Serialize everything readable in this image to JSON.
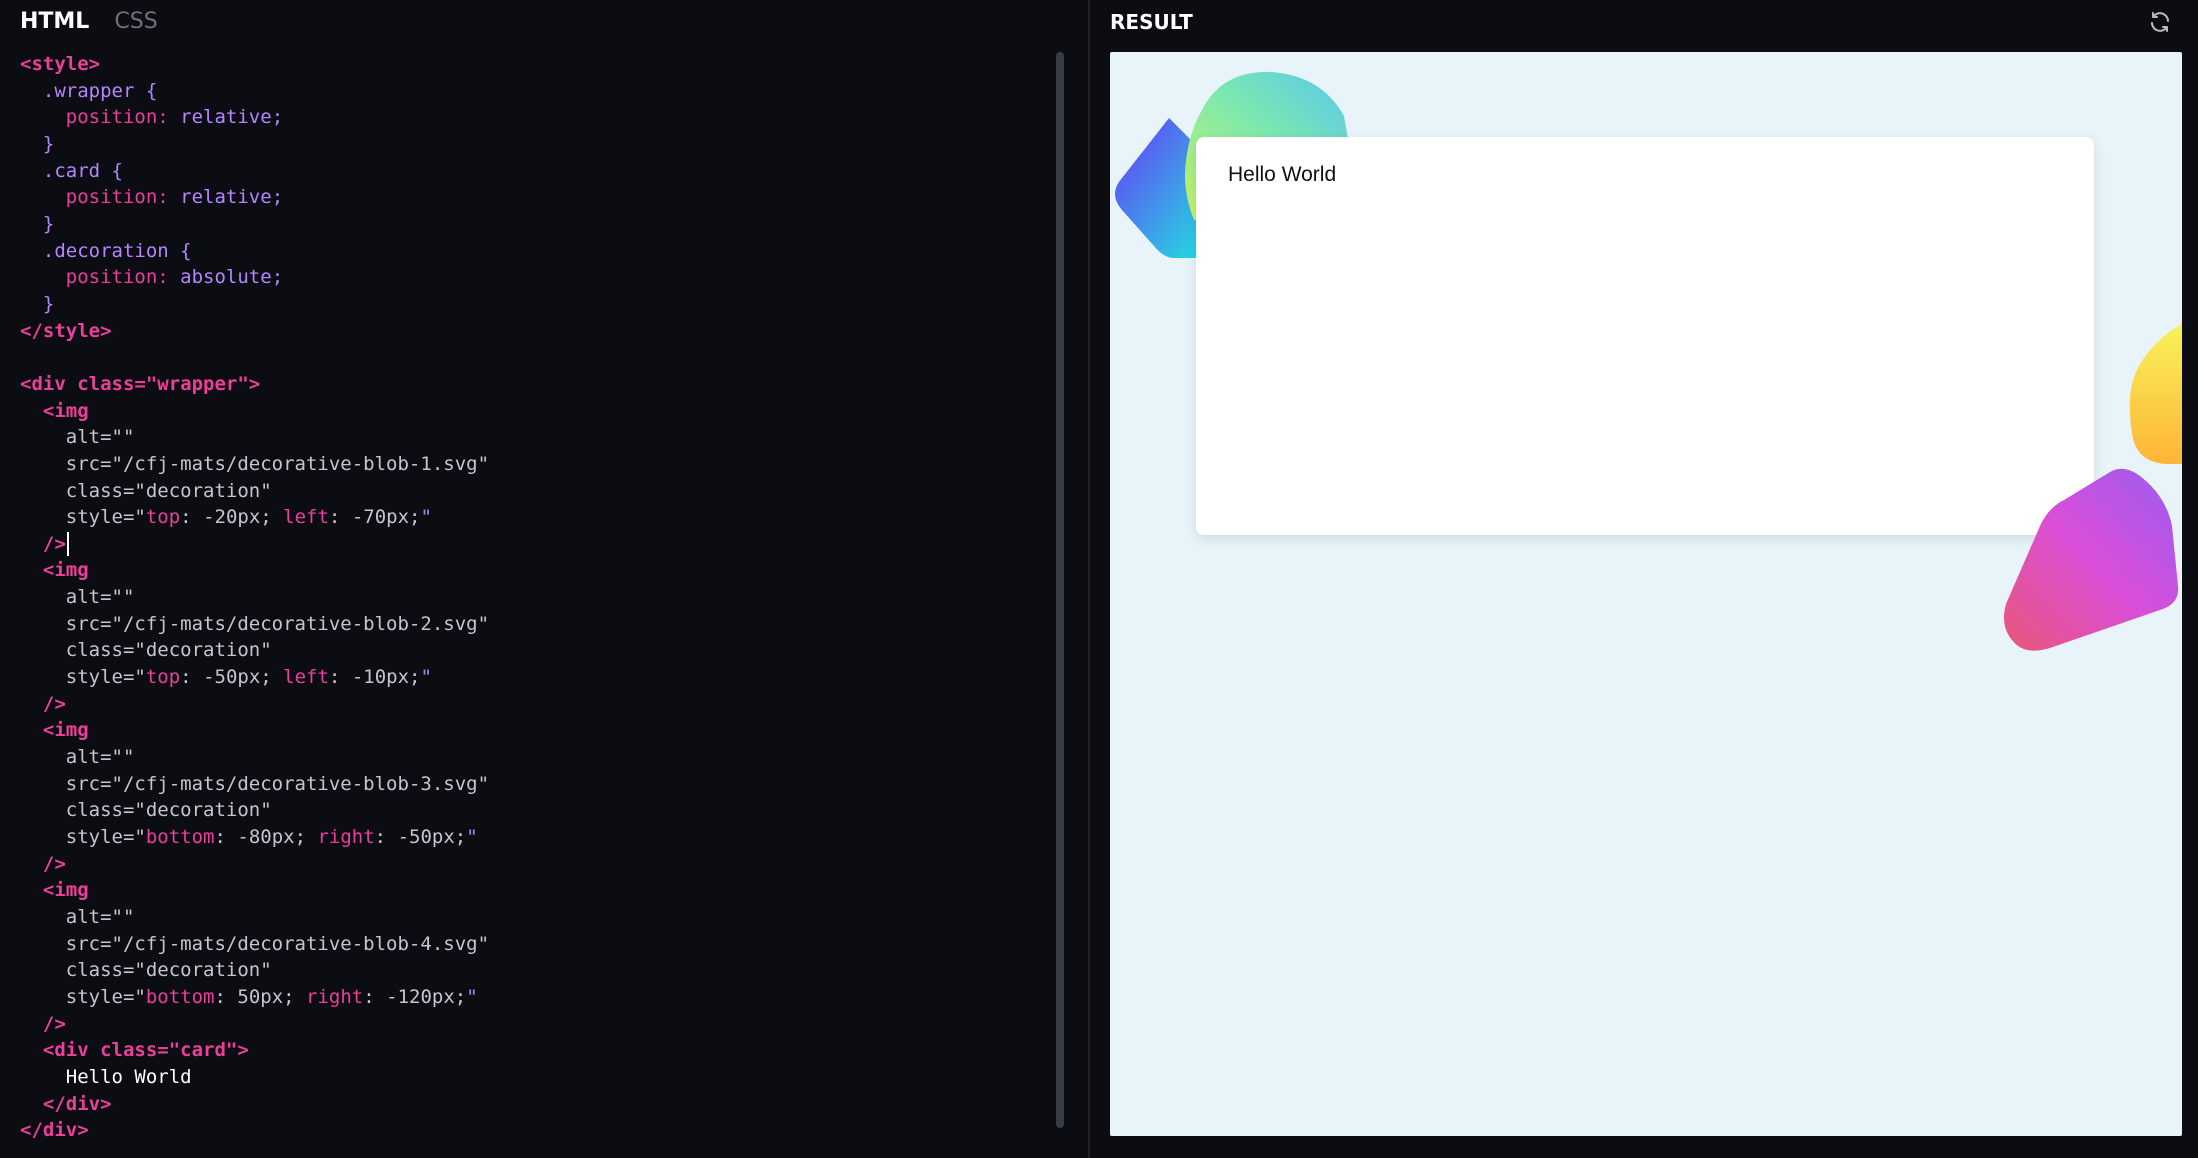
{
  "editor": {
    "tabs": [
      {
        "label": "HTML",
        "active": true
      },
      {
        "label": "CSS",
        "active": false
      }
    ]
  },
  "code": {
    "style_open": "<style>",
    "style_close": "</style>",
    "rules": [
      {
        "selector": ".wrapper",
        "property": "position",
        "value": "relative"
      },
      {
        "selector": ".card",
        "property": "position",
        "value": "relative"
      },
      {
        "selector": ".decoration",
        "property": "position",
        "value": "absolute"
      }
    ],
    "wrapper_open": "<div class=\"wrapper\">",
    "wrapper_close": "</div>",
    "images": [
      {
        "alt": "alt=\"\"",
        "src": "src=\"/cfj-mats/decorative-blob-1.svg\"",
        "class": "class=\"decoration\"",
        "p1": "top",
        "v1": "-20px",
        "p2": "left",
        "v2": "-70px"
      },
      {
        "alt": "alt=\"\"",
        "src": "src=\"/cfj-mats/decorative-blob-2.svg\"",
        "class": "class=\"decoration\"",
        "p1": "top",
        "v1": "-50px",
        "p2": "left",
        "v2": "-10px"
      },
      {
        "alt": "alt=\"\"",
        "src": "src=\"/cfj-mats/decorative-blob-3.svg\"",
        "class": "class=\"decoration\"",
        "p1": "bottom",
        "v1": "-80px",
        "p2": "right",
        "v2": "-50px"
      },
      {
        "alt": "alt=\"\"",
        "src": "src=\"/cfj-mats/decorative-blob-4.svg\"",
        "class": "class=\"decoration\"",
        "p1": "bottom",
        "v1": "50px",
        "p2": "right",
        "v2": "-120px"
      }
    ],
    "card_open": "<div class=\"card\">",
    "card_text": "Hello World",
    "card_close": "</div>"
  },
  "result": {
    "header": "RESULT",
    "refresh_icon": "refresh-icon",
    "card_text": "Hello World"
  },
  "colors": {
    "editor_bg": "#0c0d12",
    "tag": "#ea3f9b",
    "value": "#b584ff",
    "preview_bg": "#e8f4fa"
  }
}
